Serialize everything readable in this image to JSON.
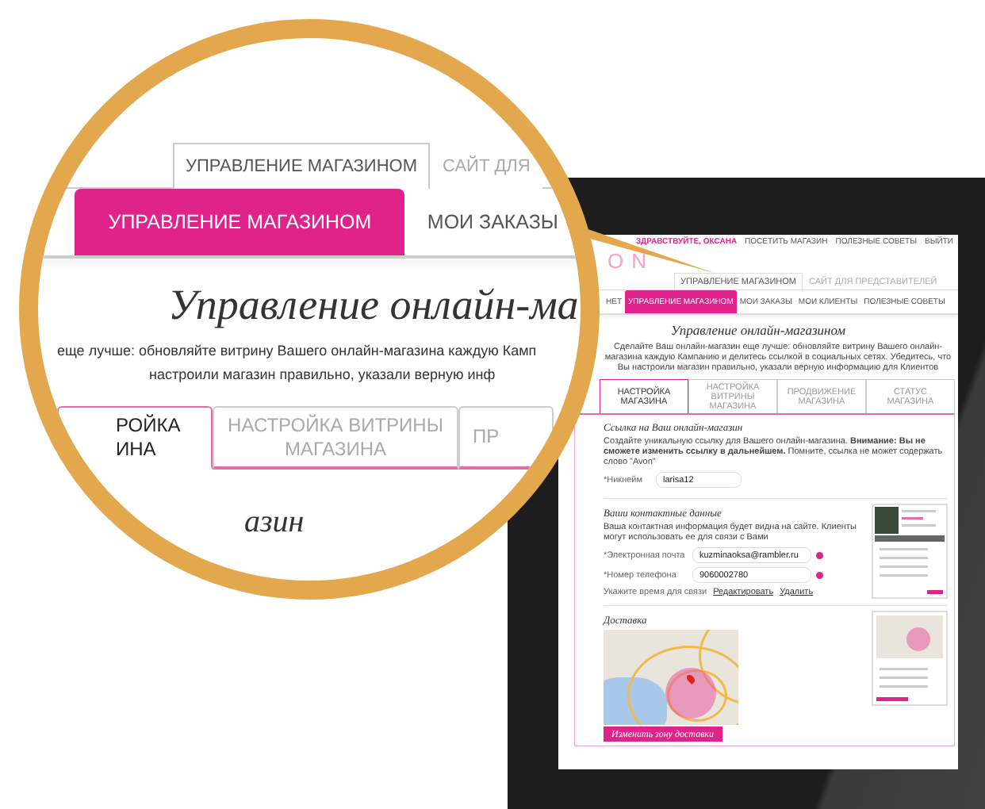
{
  "magnifier": {
    "tabs": [
      {
        "label": "УПРАВЛЕНИЕ МАГАЗИНОМ",
        "selected": true
      },
      {
        "label": "САЙТ ДЛЯ",
        "selected": false
      }
    ],
    "nav": [
      {
        "label": "УПРАВЛЕНИЕ МАГАЗИНОМ",
        "selected": true
      },
      {
        "label": "МОИ ЗАКАЗЫ",
        "selected": false
      }
    ],
    "heading": "Управление онлайн-ма",
    "intro_lines": [
      "еще лучше: обновляйте витрину Вашего онлайн-магазина каждую Камп",
      "настроили магазин правильно, указали верную инф"
    ],
    "subtabs": [
      {
        "lines": [
          "РОЙКА",
          "ИНА"
        ],
        "selected": true
      },
      {
        "lines": [
          "НАСТРОЙКА ВИТРИНЫ",
          "МАГАЗИНА"
        ],
        "selected": false
      },
      {
        "lines": [
          "ПР"
        ],
        "selected": false
      }
    ],
    "section_title": "азин"
  },
  "tablet": {
    "top_links": [
      {
        "label": "ЗДРАВСТВУЙТЕ, ОКСАНА",
        "kind": "greeting"
      },
      {
        "label": "ПОСЕТИТЬ МАГАЗИН",
        "kind": "link"
      },
      {
        "label": "ПОЛЕЗНЫЕ СОВЕТЫ",
        "kind": "link"
      },
      {
        "label": "ВЫЙТИ",
        "kind": "link"
      }
    ],
    "logo": "ON",
    "tabs": [
      {
        "label": "УПРАВЛЕНИЕ МАГАЗИНОМ",
        "selected": true
      },
      {
        "label": "САЙТ ДЛЯ ПРЕДСТАВИТЕЛЕЙ",
        "selected": false
      }
    ],
    "nav": [
      {
        "label": "НЕТ",
        "selected": false
      },
      {
        "label": "УПРАВЛЕНИЕ МАГАЗИНОМ",
        "selected": true
      },
      {
        "label": "МОИ ЗАКАЗЫ",
        "selected": false
      },
      {
        "label": "МОИ КЛИЕНТЫ",
        "selected": false
      },
      {
        "label": "ПОЛЕЗНЫЕ СОВЕТЫ",
        "selected": false
      }
    ],
    "heading": "Управление онлайн-магазином",
    "intro": "Сделайте Ваш онлайн-магазин еще лучше: обновляйте витрину Вашего онлайн-магазина каждую Кампанию и делитесь ссылкой в социальных сетях. Убедитесь, что Вы настроили магазин правильно, указали верную информацию для Клиентов",
    "subtabs": [
      {
        "label": "НАСТРОЙКА МАГАЗИНА",
        "selected": true
      },
      {
        "label": "НАСТРОЙКА ВИТРИНЫ МАГАЗИНА",
        "selected": false
      },
      {
        "label": "ПРОДВИЖЕНИЕ МАГАЗИНА",
        "selected": false
      },
      {
        "label": "СТАТУС МАГАЗИНА",
        "selected": false
      }
    ],
    "link_section": {
      "title": "Ссылка на Ваш онлайн-магазин",
      "description": "Создайте уникальную ссылку для Вашего онлайн-магазина. **Внимание: Вы не сможете изменить ссылку в дальнейшем.** Помните, ссылка не может содержать слово \"Avon\"",
      "field_label": "*Никнейм",
      "field_value": "larisa12"
    },
    "contacts": {
      "title": "Ваши контактные данные",
      "description": "Ваша контактная информация будет видна на сайте. Клиенты могут использовать ее для связи с Вами",
      "fields": [
        {
          "label": "*Электронная почта",
          "value": "kuzminaoksa@rambler.ru"
        },
        {
          "label": "*Номер телефона",
          "value": "9060002780"
        }
      ],
      "time_label": "Укажите время для связи",
      "actions": [
        "Редактировать",
        "Удалить"
      ]
    },
    "delivery": {
      "title": "Доставка",
      "button": "Изменить зону доставки"
    }
  }
}
